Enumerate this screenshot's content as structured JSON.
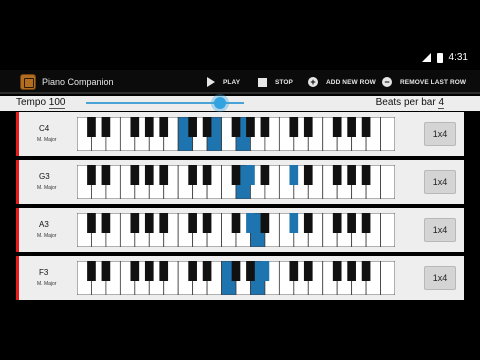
{
  "status_bar": {
    "time": "4:31",
    "icons": [
      "signal-icon",
      "battery-icon"
    ]
  },
  "action_bar": {
    "title": "Piano Companion",
    "actions": [
      {
        "label": "PLAY",
        "icon": "play-icon"
      },
      {
        "label": "STOP",
        "icon": "stop-icon"
      },
      {
        "label": "ADD NEW ROW",
        "icon": "plus-circle-icon"
      },
      {
        "label": "REMOVE LAST ROW",
        "icon": "minus-circle-icon"
      }
    ]
  },
  "settings": {
    "tempo_label": "Tempo",
    "tempo_value": "100",
    "tempo_slider_fraction": 0.85,
    "beats_label": "Beats per bar",
    "beats_value": "4"
  },
  "colors": {
    "highlight": "#1e74ae",
    "accent_bar": "#e41c1c",
    "slider": "#33a2e0"
  },
  "rows": [
    {
      "chord": "C4",
      "scale": "M. Major",
      "button": "1x4",
      "white_highlights": [
        7,
        9,
        11
      ],
      "black_highlights": []
    },
    {
      "chord": "G3",
      "scale": "M. Major",
      "button": "1x4",
      "white_highlights": [
        11
      ],
      "black_highlights": [
        8,
        10
      ]
    },
    {
      "chord": "A3",
      "scale": "M. Major",
      "button": "1x4",
      "white_highlights": [
        12
      ],
      "black_highlights": [
        8,
        10
      ]
    },
    {
      "chord": "F3",
      "scale": "M. Major",
      "button": "1x4",
      "white_highlights": [
        10,
        12
      ],
      "black_highlights": [
        9
      ]
    }
  ]
}
